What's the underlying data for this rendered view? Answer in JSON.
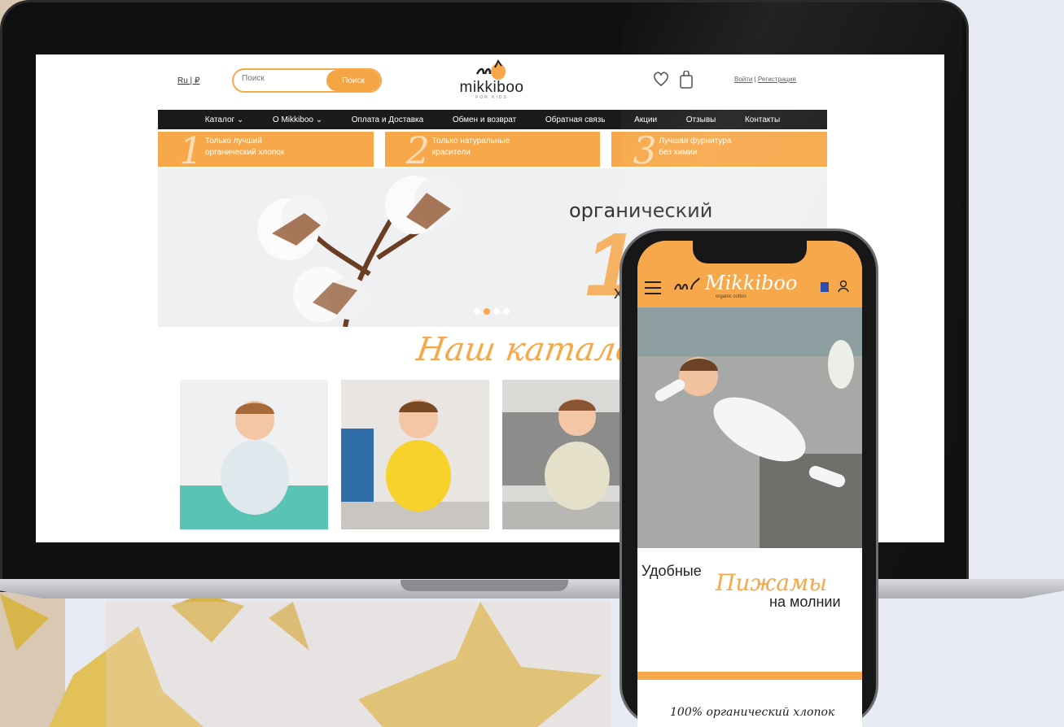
{
  "colors": {
    "accent": "#f7a84a",
    "nav_bg": "#1b1b1b",
    "text": "#222222"
  },
  "desktop": {
    "lang": "Ru | ₽",
    "search": {
      "placeholder": "Поиск",
      "button": "Поиск"
    },
    "logo": {
      "name": "mikkiboo",
      "tagline": "FOR KIDS"
    },
    "icons": [
      "heart-icon",
      "shopping-bag-icon"
    ],
    "auth": {
      "login": "Войти",
      "separator": " | ",
      "register": "Регистрация"
    },
    "nav": [
      {
        "label": "Каталог ⌄"
      },
      {
        "label": "О Mikkiboo ⌄"
      },
      {
        "label": "Оплата и Доставка"
      },
      {
        "label": "Обмен и возврат"
      },
      {
        "label": "Обратная связь"
      },
      {
        "label": "Акции"
      },
      {
        "label": "Отзывы"
      },
      {
        "label": "Контакты"
      }
    ],
    "features": [
      {
        "num": "1",
        "text": "Только лучший\nорганический хлопок"
      },
      {
        "num": "2",
        "text": "Только натуральные\nкрасители"
      },
      {
        "num": "3",
        "text": "Лучшая фурнитура\nбез химии"
      }
    ],
    "hero": {
      "text1": "органический",
      "big": "100",
      "text2": "х"
    },
    "slider": {
      "count": 4,
      "active": 1
    },
    "catalog_title": "Наш каталог"
  },
  "mobile": {
    "logo": "Mikkiboo",
    "logo_sub": "organic cotton",
    "icons": [
      "menu-icon",
      "cart-icon",
      "user-icon"
    ],
    "title_line1": "Удобные",
    "title_line2": "Пижамы",
    "title_line3": "на молнии",
    "footer_text": "100% органический хлопок"
  }
}
